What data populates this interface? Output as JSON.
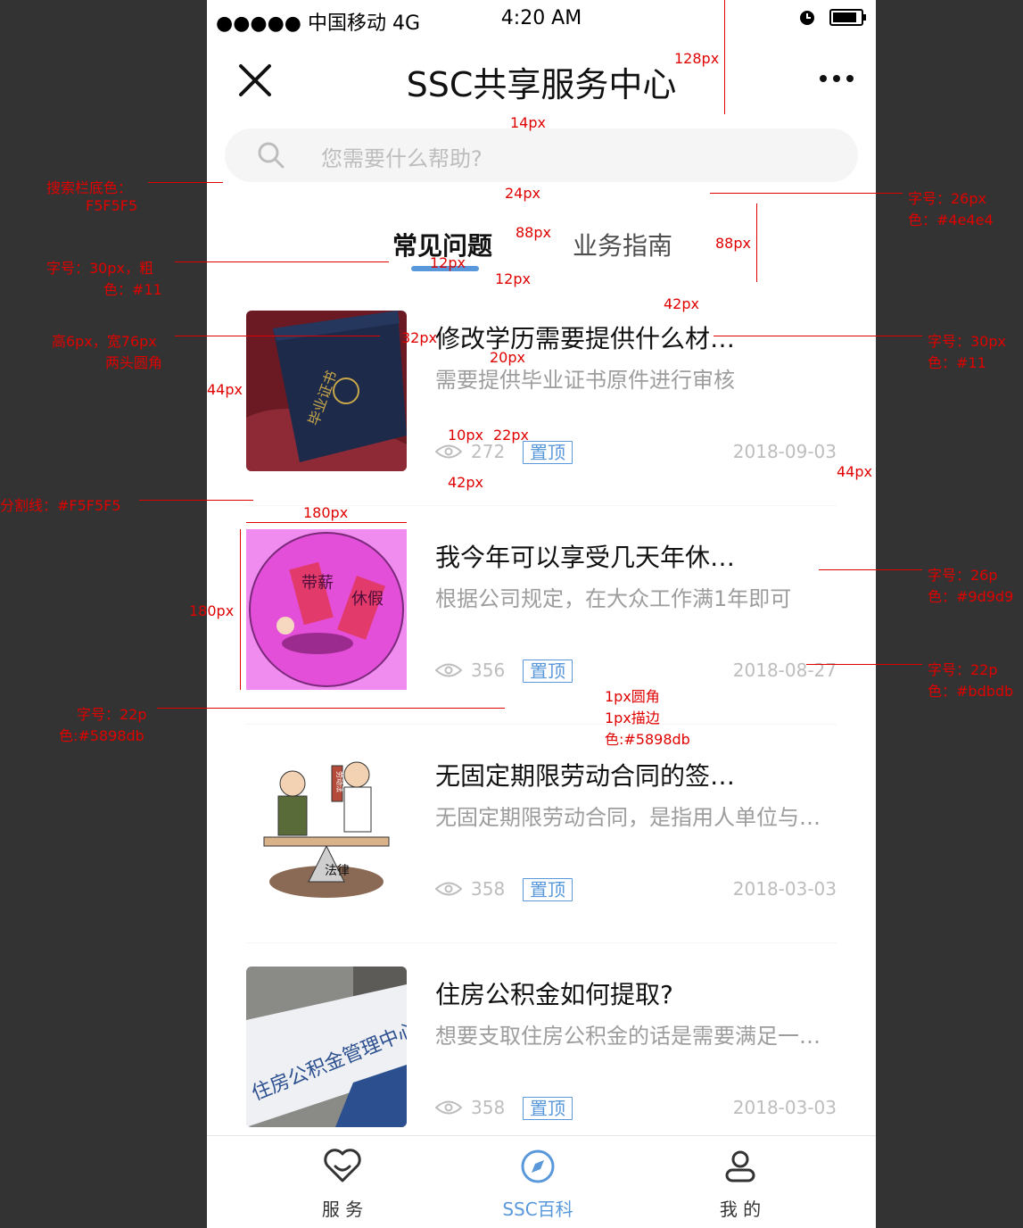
{
  "status": {
    "carrier": "●●●●● 中国移动 4G",
    "time": "4:20 AM"
  },
  "navbar": {
    "title": "SSC共享服务中心"
  },
  "search": {
    "placeholder": "您需要什么帮助?"
  },
  "tabs": [
    {
      "label": "常见问题",
      "active": true
    },
    {
      "label": "业务指南",
      "active": false
    }
  ],
  "items": [
    {
      "title": "修改学历需要提供什么材…",
      "desc": "需要提供毕业证书原件进行审核",
      "views": "272",
      "pin": "置顶",
      "date": "2018-09-03"
    },
    {
      "title": "我今年可以享受几天年休…",
      "desc": "根据公司规定，在大众工作满1年即可",
      "views": "356",
      "pin": "置顶",
      "date": "2018-08-27"
    },
    {
      "title": "无固定期限劳动合同的签…",
      "desc": "无固定期限劳动合同，是指用人单位与…",
      "views": "358",
      "pin": "置顶",
      "date": "2018-03-03"
    },
    {
      "title": "住房公积金如何提取?",
      "desc": "想要支取住房公积金的话是需要满足一…",
      "views": "358",
      "pin": "置顶",
      "date": "2018-03-03"
    }
  ],
  "thumbs": [
    {
      "text": "毕业证书"
    },
    {
      "text_a": "带薪",
      "text_b": "休假"
    },
    {
      "text_a": "劳动法",
      "text_b": "法律"
    },
    {
      "text": "住房公积金管理中心"
    }
  ],
  "tabbar": [
    {
      "label": "服 务",
      "icon": "heart-icon",
      "active": false
    },
    {
      "label": "SSC百科",
      "icon": "compass-icon",
      "active": true
    },
    {
      "label": "我 的",
      "icon": "user-icon",
      "active": false
    }
  ],
  "colors": {
    "accent": "#5898db",
    "search_bg": "#F5F5F5",
    "title": "#111111",
    "desc": "#9d9d9d",
    "meta": "#bdbdbd",
    "tab_inactive": "#4e4e4e"
  },
  "annotations": {
    "a128": "128px",
    "a14": "14px",
    "a24": "24px",
    "a88a": "88px",
    "a88b": "88px",
    "a12a": "12px",
    "a12b": "12px",
    "a42a": "42px",
    "a32": "32px",
    "a20": "20px",
    "a44a": "44px",
    "a10": "10px",
    "a22": "22px",
    "a42b": "42px",
    "a44b": "44px",
    "a180a": "180px",
    "a180b": "180px",
    "search_bg_1": "搜索栏底色：",
    "search_bg_2": "F5F5F5",
    "tab_font_1": "字号：30px，粗",
    "tab_font_2": "色：#11",
    "indicator_1": "高6px，宽76px",
    "indicator_2": "两头圆角",
    "inactive_1": "字号：26px",
    "inactive_2": "色：#4e4e4",
    "title_font_1": "字号：30px",
    "title_font_2": "色：#11",
    "divider": "分割线：#F5F5F5",
    "desc_font_1": "字号：26p",
    "desc_font_2": "色：#9d9d9",
    "date_font_1": "字号：22p",
    "date_font_2": "色：#bdbdb",
    "pin_font_1": "字号：22p",
    "pin_font_2": "色:#5898db",
    "pin_border_1": "1px圆角",
    "pin_border_2": "1px描边",
    "pin_border_3": "色:#5898db"
  }
}
